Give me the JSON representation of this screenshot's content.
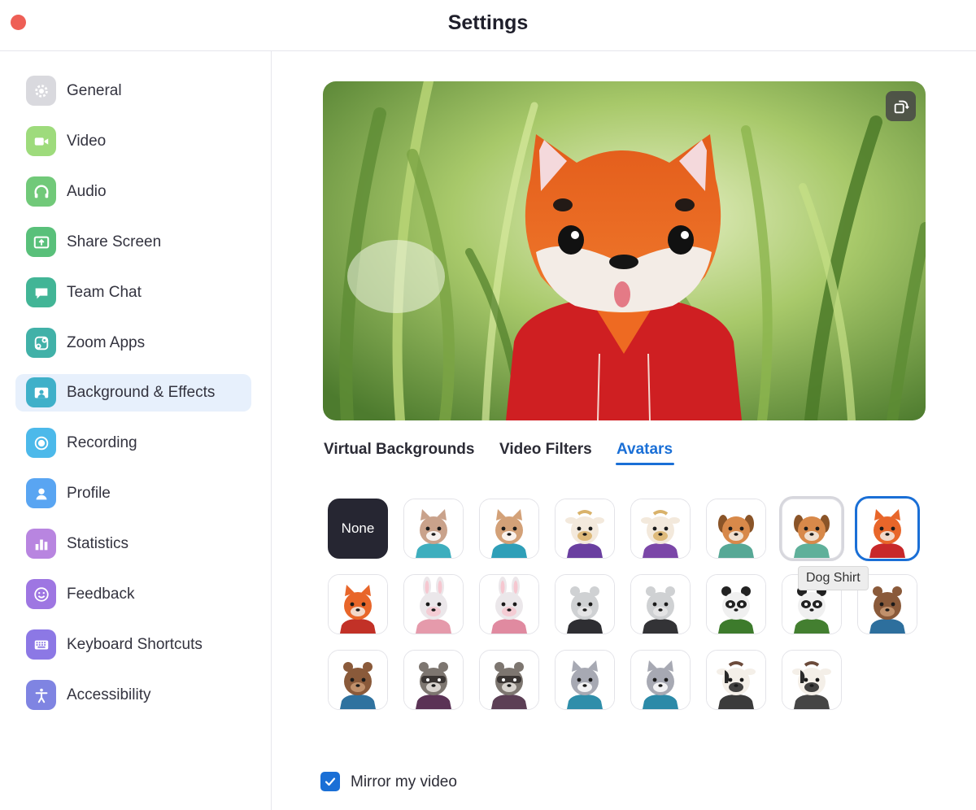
{
  "window": {
    "title": "Settings"
  },
  "sidebar": {
    "items": [
      {
        "label": "General",
        "icon": "gear-icon",
        "color": "#d6d6dc"
      },
      {
        "label": "Video",
        "icon": "video-camera-icon",
        "color": "#9edb7c"
      },
      {
        "label": "Audio",
        "icon": "headphones-icon",
        "color": "#71c979"
      },
      {
        "label": "Share Screen",
        "icon": "share-screen-icon",
        "color": "#59c07a"
      },
      {
        "label": "Team Chat",
        "icon": "chat-bubble-icon",
        "color": "#42b596"
      },
      {
        "label": "Zoom Apps",
        "icon": "apps-icon",
        "color": "#41b1a8"
      },
      {
        "label": "Background & Effects",
        "icon": "background-icon",
        "color": "#3fb0c9",
        "active": true
      },
      {
        "label": "Recording",
        "icon": "record-icon",
        "color": "#4cb9ea"
      },
      {
        "label": "Profile",
        "icon": "profile-icon",
        "color": "#59a5f2"
      },
      {
        "label": "Statistics",
        "icon": "bar-chart-icon",
        "color": "#b885e0"
      },
      {
        "label": "Feedback",
        "icon": "smiley-icon",
        "color": "#9e76e2"
      },
      {
        "label": "Keyboard Shortcuts",
        "icon": "keyboard-icon",
        "color": "#8c78e5"
      },
      {
        "label": "Accessibility",
        "icon": "accessibility-icon",
        "color": "#7f84e2"
      }
    ]
  },
  "tabs": [
    {
      "label": "Virtual Backgrounds"
    },
    {
      "label": "Video Filters"
    },
    {
      "label": "Avatars",
      "active": true
    }
  ],
  "avatars": {
    "none_label": "None",
    "tooltip": "Dog Shirt",
    "accent": "#1a6fd6"
  },
  "mirror": {
    "label": "Mirror my video",
    "checked": true
  }
}
